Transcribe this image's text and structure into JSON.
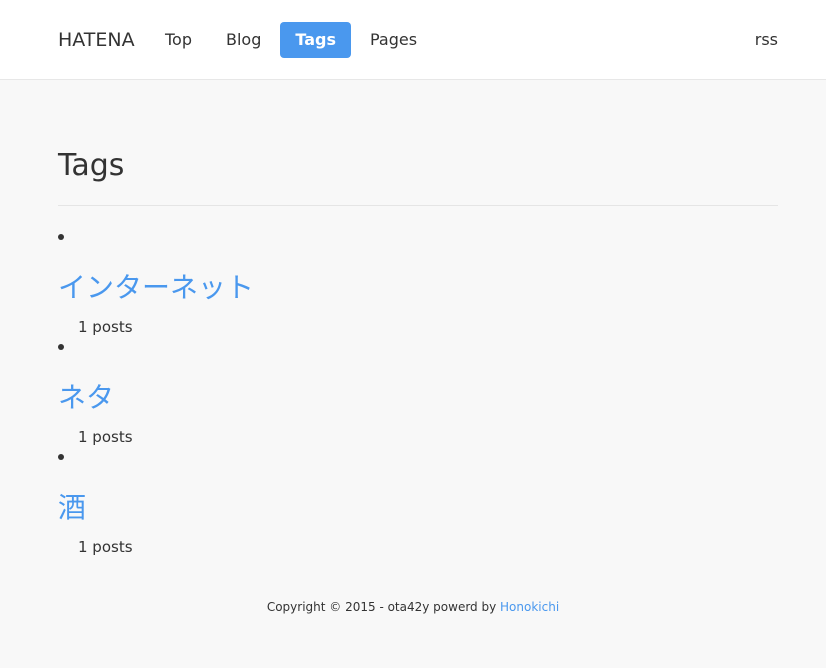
{
  "header": {
    "brand": "HATENA",
    "nav": [
      {
        "label": "Top",
        "active": false
      },
      {
        "label": "Blog",
        "active": false
      },
      {
        "label": "Tags",
        "active": true
      },
      {
        "label": "Pages",
        "active": false
      }
    ],
    "rss": "rss"
  },
  "main": {
    "title": "Tags",
    "tags": [
      {
        "name": "インターネット",
        "count": "1 posts"
      },
      {
        "name": "ネタ",
        "count": "1 posts"
      },
      {
        "name": "酒",
        "count": "1 posts"
      }
    ]
  },
  "footer": {
    "copyright": "Copyright © 2015 - ota42y powerd by ",
    "link_label": "Honokichi"
  },
  "colors": {
    "accent": "#4a98ee",
    "background": "#f8f8f8",
    "navbar": "#ffffff",
    "text": "#333333"
  }
}
